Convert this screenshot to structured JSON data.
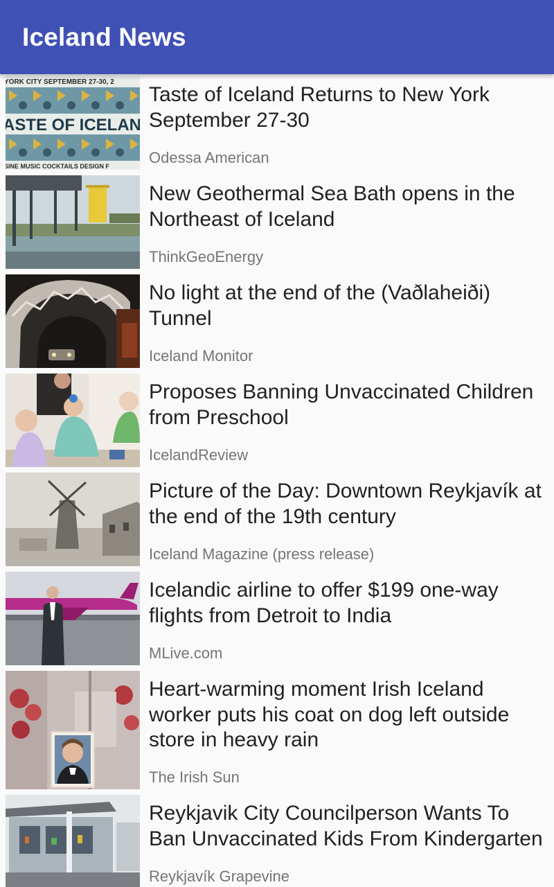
{
  "app": {
    "title": "Iceland News"
  },
  "articles": [
    {
      "title": "Taste of Iceland Returns to New York September 27-30",
      "source": "Odessa American",
      "thumbnail": "taste-of-iceland-poster",
      "thumb_text_top": "YORK CITY SEPTEMBER 27-30, 2",
      "thumb_text_mid": "ASTE OF ICELAN",
      "thumb_text_bot": "SINE MUSIC COCKTAILS DESIGN F"
    },
    {
      "title": "New Geothermal Sea Bath opens in the Northeast of Iceland",
      "source": "ThinkGeoEnergy",
      "thumbnail": "geothermal-bath-photo"
    },
    {
      "title": "No light at the end of the (Vaðlaheiði) Tunnel",
      "source": "Iceland Monitor",
      "thumbnail": "tunnel-photo"
    },
    {
      "title": "Proposes Banning Unvaccinated Children from Preschool",
      "source": "IcelandReview",
      "thumbnail": "children-preschool-photo"
    },
    {
      "title": "Picture of the Day: Downtown Reykjavík at the end of the 19th century",
      "source": "Iceland Magazine (press release)",
      "thumbnail": "windmill-historic-photo"
    },
    {
      "title": "Icelandic airline to offer $199 one-way flights from Detroit to India",
      "source": "MLive.com",
      "thumbnail": "airline-man-plane-photo"
    },
    {
      "title": "Heart-warming moment Irish Iceland worker puts his coat on dog left outside store in heavy rain",
      "source": "The Irish Sun",
      "thumbnail": "dog-in-rain-photo"
    },
    {
      "title": "Reykjavik City Councilperson Wants To Ban Unvaccinated Kids From Kindergarten",
      "source": "Reykjavík Grapevine",
      "thumbnail": "kindergarten-building-photo"
    }
  ]
}
